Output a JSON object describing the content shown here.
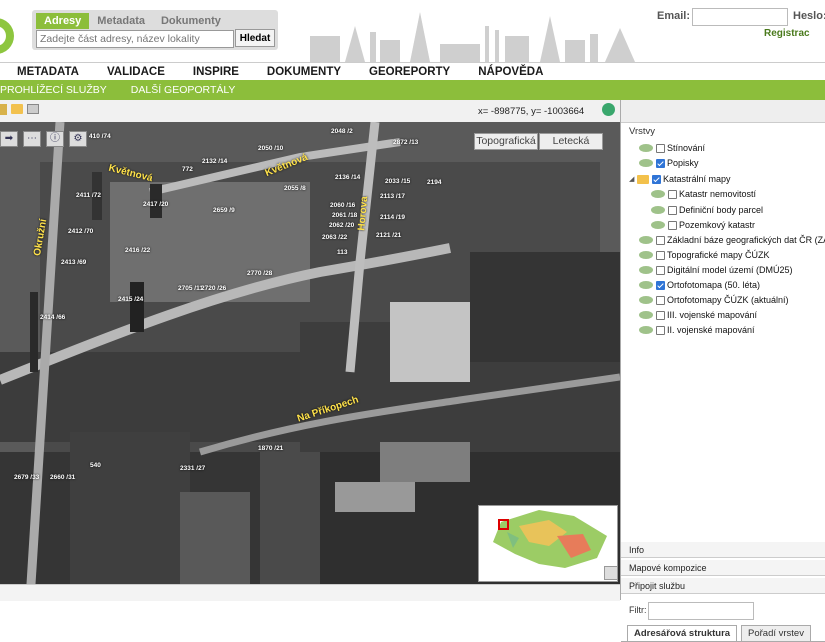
{
  "header": {
    "search_tabs": [
      "Adresy",
      "Metadata",
      "Dokumenty"
    ],
    "search_placeholder": "Zadejte část adresy, název lokality",
    "search_button": "Hledat",
    "email_label": "Email:",
    "password_label": "Heslo:",
    "register_link": "Registrac"
  },
  "menu": [
    "METADATA",
    "VALIDACE",
    "INSPIRE",
    "DOKUMENTY",
    "GEOREPORTY",
    "NÁPOVĚDA"
  ],
  "submenu": [
    "PROHLÍŽECÍ SLUŽBY",
    "DALŠÍ GEOPORTÁLY"
  ],
  "map": {
    "coordinates": "x= -898775, y= -1003664",
    "type_buttons": [
      "Topografická",
      "Letecká"
    ],
    "streets": [
      "Květnová",
      "Květnová",
      "Okružní",
      "Horova",
      "Na Příkopech"
    ],
    "parcels": [
      "410 /74",
      "2048 /2",
      "2872 /13",
      "2050 /10",
      "2132 /14",
      "772",
      "2136 /14",
      "2033 /15",
      "2194",
      "2055 /8",
      "2113 /17",
      "2411 /72",
      "2417 /20",
      "2060 /16",
      "2061 /18",
      "2062 /20",
      "2063 /22",
      "2114 /19",
      "2121 /21",
      "2412 /70",
      "2659 /9",
      "113",
      "2416 /22",
      "2413 /69",
      "2770 /28",
      "2705 /11",
      "2720 /26",
      "2415 /24",
      "2414 /66",
      "1870 /21",
      "540",
      "2331 /27",
      "2679 /33",
      "2660 /31"
    ]
  },
  "panel": {
    "title": "Vrstvy",
    "layers": [
      {
        "label": "Stínování",
        "checked": false,
        "indent": 1
      },
      {
        "label": "Popisky",
        "checked": true,
        "indent": 1
      },
      {
        "label": "Katastrální mapy",
        "checked": true,
        "indent": 0,
        "folder": true
      },
      {
        "label": "Katastr nemovitostí",
        "checked": false,
        "indent": 2
      },
      {
        "label": "Definiční body parcel",
        "checked": false,
        "indent": 2
      },
      {
        "label": "Pozemkový katastr",
        "checked": false,
        "indent": 2
      },
      {
        "label": "Základní báze geografických dat ČR (ZABAG",
        "checked": false,
        "indent": 1
      },
      {
        "label": "Topografické mapy ČÚZK",
        "checked": false,
        "indent": 1
      },
      {
        "label": "Digitální model území (DMÚ25)",
        "checked": false,
        "indent": 1
      },
      {
        "label": "Ortofotomapa (50. léta)",
        "checked": true,
        "indent": 1
      },
      {
        "label": "Ortofotomapy ČÚZK (aktuální)",
        "checked": false,
        "indent": 1
      },
      {
        "label": "III. vojenské mapování",
        "checked": false,
        "indent": 1
      },
      {
        "label": "II. vojenské mapování",
        "checked": false,
        "indent": 1
      }
    ],
    "filter_label": "Filtr:",
    "tabs": [
      "Adresářová struktura",
      "Pořadí vrstev"
    ],
    "sections": [
      "Info",
      "Mapové kompozice",
      "Připojit službu"
    ]
  }
}
